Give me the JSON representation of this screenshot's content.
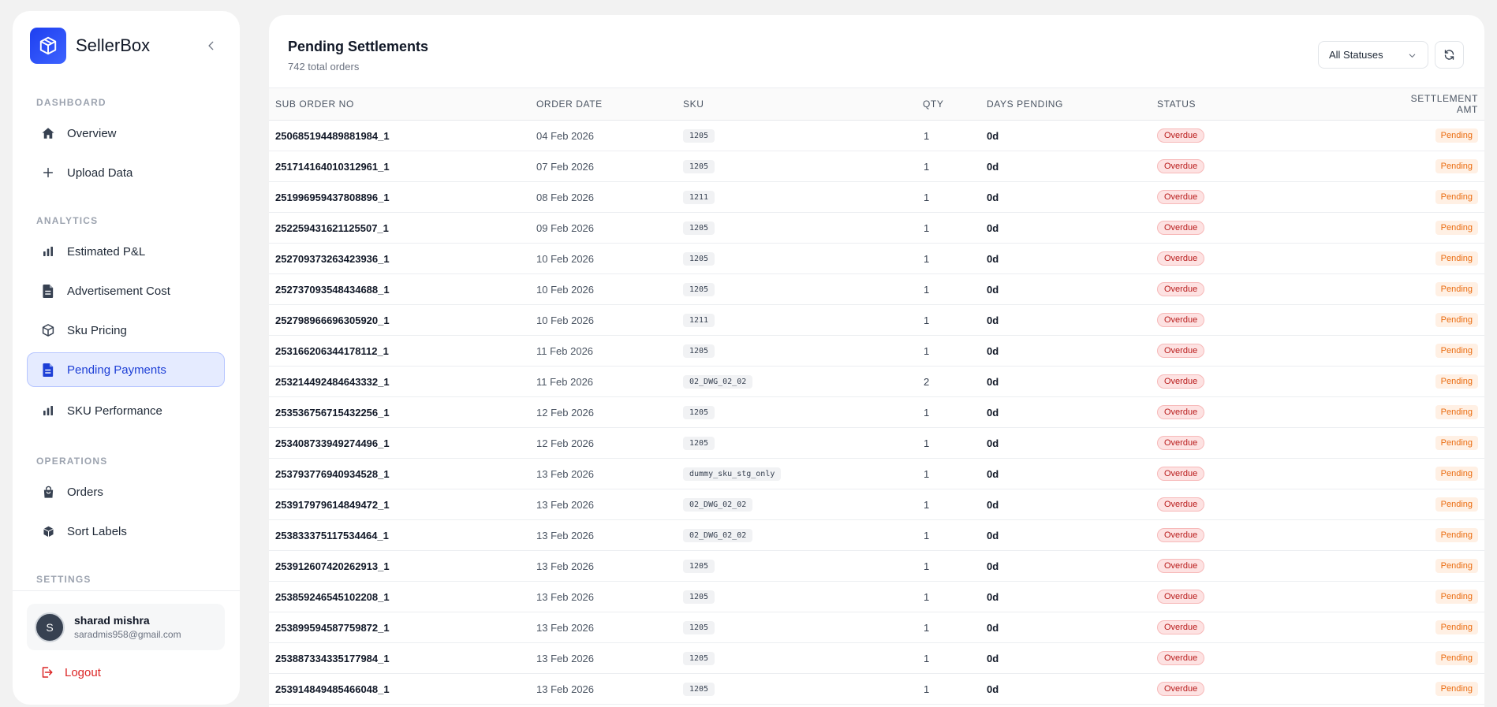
{
  "sidebar": {
    "brand": "SellerBox",
    "sections": {
      "dashboard": "DASHBOARD",
      "analytics": "ANALYTICS",
      "operations": "OPERATIONS",
      "settings": "SETTINGS"
    },
    "items": {
      "overview": "Overview",
      "upload": "Upload Data",
      "pnl": "Estimated P&L",
      "ad_cost": "Advertisement Cost",
      "sku_pricing": "Sku Pricing",
      "pending_payments": "Pending Payments",
      "sku_performance": "SKU Performance",
      "orders": "Orders",
      "sort_labels": "Sort Labels"
    },
    "active_item": "Pending Payments",
    "user": {
      "initial": "S",
      "name": "sharad mishra",
      "email": "saradmis958@gmail.com"
    },
    "logout": "Logout"
  },
  "main": {
    "title": "Pending Settlements",
    "subtitle": "742 total orders",
    "status_filter": "All Statuses",
    "columns": [
      "SUB ORDER NO",
      "ORDER DATE",
      "SKU",
      "QTY",
      "DAYS PENDING",
      "STATUS",
      "SETTLEMENT AMT"
    ],
    "rows": [
      {
        "order": "250685194489881984_1",
        "date": "04 Feb 2026",
        "sku": "1205",
        "qty": "1",
        "days": "0d",
        "status": "Overdue",
        "amt": "Pending"
      },
      {
        "order": "251714164010312961_1",
        "date": "07 Feb 2026",
        "sku": "1205",
        "qty": "1",
        "days": "0d",
        "status": "Overdue",
        "amt": "Pending"
      },
      {
        "order": "251996959437808896_1",
        "date": "08 Feb 2026",
        "sku": "1211",
        "qty": "1",
        "days": "0d",
        "status": "Overdue",
        "amt": "Pending"
      },
      {
        "order": "252259431621125507_1",
        "date": "09 Feb 2026",
        "sku": "1205",
        "qty": "1",
        "days": "0d",
        "status": "Overdue",
        "amt": "Pending"
      },
      {
        "order": "252709373263423936_1",
        "date": "10 Feb 2026",
        "sku": "1205",
        "qty": "1",
        "days": "0d",
        "status": "Overdue",
        "amt": "Pending"
      },
      {
        "order": "252737093548434688_1",
        "date": "10 Feb 2026",
        "sku": "1205",
        "qty": "1",
        "days": "0d",
        "status": "Overdue",
        "amt": "Pending"
      },
      {
        "order": "252798966696305920_1",
        "date": "10 Feb 2026",
        "sku": "1211",
        "qty": "1",
        "days": "0d",
        "status": "Overdue",
        "amt": "Pending"
      },
      {
        "order": "253166206344178112_1",
        "date": "11 Feb 2026",
        "sku": "1205",
        "qty": "1",
        "days": "0d",
        "status": "Overdue",
        "amt": "Pending"
      },
      {
        "order": "253214492484643332_1",
        "date": "11 Feb 2026",
        "sku": "02_DWG_02_02",
        "qty": "2",
        "days": "0d",
        "status": "Overdue",
        "amt": "Pending"
      },
      {
        "order": "253536756715432256_1",
        "date": "12 Feb 2026",
        "sku": "1205",
        "qty": "1",
        "days": "0d",
        "status": "Overdue",
        "amt": "Pending"
      },
      {
        "order": "253408733949274496_1",
        "date": "12 Feb 2026",
        "sku": "1205",
        "qty": "1",
        "days": "0d",
        "status": "Overdue",
        "amt": "Pending"
      },
      {
        "order": "253793776940934528_1",
        "date": "13 Feb 2026",
        "sku": "dummy_sku_stg_only",
        "qty": "1",
        "days": "0d",
        "status": "Overdue",
        "amt": "Pending"
      },
      {
        "order": "253917979614849472_1",
        "date": "13 Feb 2026",
        "sku": "02_DWG_02_02",
        "qty": "1",
        "days": "0d",
        "status": "Overdue",
        "amt": "Pending"
      },
      {
        "order": "253833375117534464_1",
        "date": "13 Feb 2026",
        "sku": "02_DWG_02_02",
        "qty": "1",
        "days": "0d",
        "status": "Overdue",
        "amt": "Pending"
      },
      {
        "order": "253912607420262913_1",
        "date": "13 Feb 2026",
        "sku": "1205",
        "qty": "1",
        "days": "0d",
        "status": "Overdue",
        "amt": "Pending"
      },
      {
        "order": "253859246545102208_1",
        "date": "13 Feb 2026",
        "sku": "1205",
        "qty": "1",
        "days": "0d",
        "status": "Overdue",
        "amt": "Pending"
      },
      {
        "order": "253899594587759872_1",
        "date": "13 Feb 2026",
        "sku": "1205",
        "qty": "1",
        "days": "0d",
        "status": "Overdue",
        "amt": "Pending"
      },
      {
        "order": "253887334335177984_1",
        "date": "13 Feb 2026",
        "sku": "1205",
        "qty": "1",
        "days": "0d",
        "status": "Overdue",
        "amt": "Pending"
      },
      {
        "order": "253914849485466048_1",
        "date": "13 Feb 2026",
        "sku": "1205",
        "qty": "1",
        "days": "0d",
        "status": "Overdue",
        "amt": "Pending"
      }
    ]
  },
  "colors": {
    "accent": "#1d3fd6",
    "overdue": "#b91c1c",
    "pending": "#ea6c10",
    "logout": "#dc2626"
  }
}
